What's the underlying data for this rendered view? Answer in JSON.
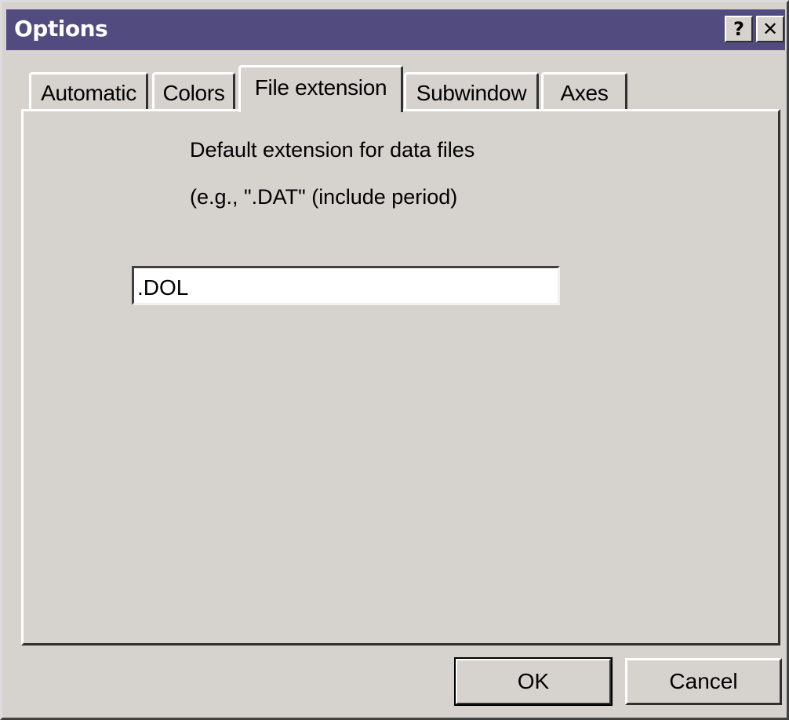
{
  "window": {
    "title": "Options",
    "help_glyph": "?",
    "close_glyph": "✕"
  },
  "tabs": [
    {
      "label": "Automatic",
      "selected": false
    },
    {
      "label": "Colors",
      "selected": false
    },
    {
      "label": "File extension",
      "selected": true
    },
    {
      "label": "Subwindow",
      "selected": false
    },
    {
      "label": "Axes",
      "selected": false
    }
  ],
  "file_extension_panel": {
    "description_line1": "Default extension for data files",
    "description_line2": "(e.g., \".DAT\" (include period)",
    "extension_value": ".DOL"
  },
  "buttons": {
    "ok_label": "OK",
    "cancel_label": "Cancel"
  },
  "colors": {
    "titlebar": "#524b80",
    "face": "#d6d3ce"
  }
}
